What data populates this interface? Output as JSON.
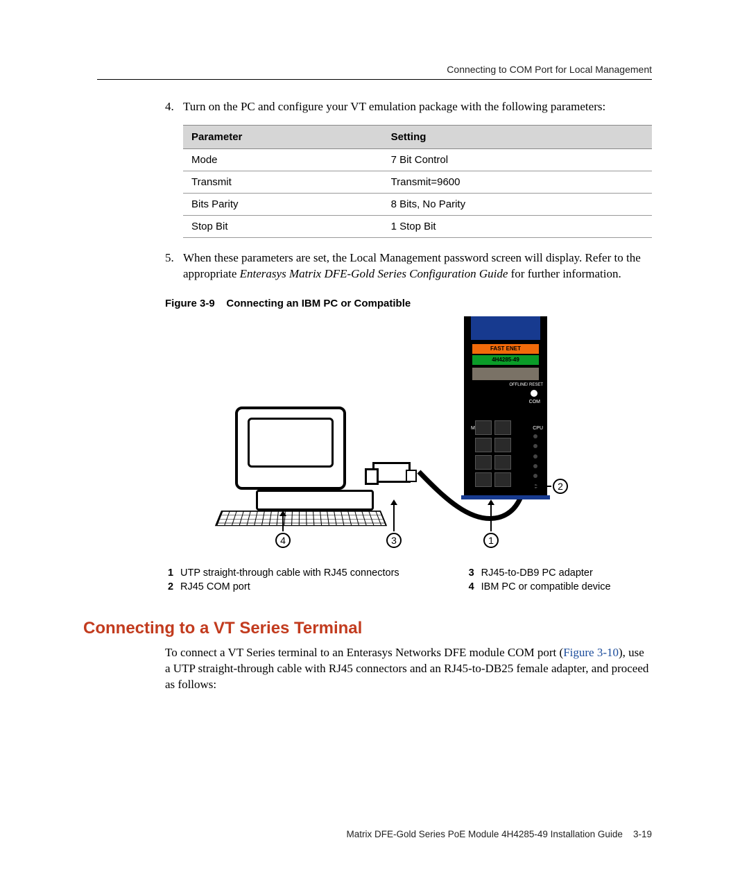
{
  "header": {
    "running_title": "Connecting to COM Port for Local Management"
  },
  "steps": {
    "s4": {
      "num": "4.",
      "text": "Turn on the PC and configure your VT emulation package with the following parameters:"
    },
    "s5": {
      "num": "5.",
      "text_a": "When these parameters are set, the Local Management password screen will display. Refer to the appropriate ",
      "text_em": "Enterasys Matrix DFE-Gold Series Configuration Guide",
      "text_b": " for further information."
    }
  },
  "param_table": {
    "headers": {
      "param": "Parameter",
      "setting": "Setting"
    },
    "rows": [
      {
        "param": "Mode",
        "setting": "7 Bit Control"
      },
      {
        "param": "Transmit",
        "setting": "Transmit=9600"
      },
      {
        "param": "Bits Parity",
        "setting": "8 Bits, No Parity"
      },
      {
        "param": "Stop Bit",
        "setting": "1 Stop Bit"
      }
    ]
  },
  "figure": {
    "caption_label": "Figure 3-9",
    "caption_text": "Connecting an IBM PC or Compatible",
    "callouts": {
      "c1": "1",
      "c2": "2",
      "c3": "3",
      "c4": "4"
    },
    "module_labels": {
      "fast_enet": "FAST ENET",
      "model": "4H4285-49",
      "offline": "OFFLINE/\nRESET",
      "com": "COM",
      "cpu": "CPU",
      "mg": "MG"
    },
    "legend": [
      {
        "k": "1",
        "v": "UTP straight-through cable with RJ45 connectors"
      },
      {
        "k": "2",
        "v": "RJ45 COM port"
      },
      {
        "k": "3",
        "v": "RJ45-to-DB9 PC adapter"
      },
      {
        "k": "4",
        "v": "IBM PC or compatible device"
      }
    ]
  },
  "section": {
    "heading": "Connecting to a VT Series Terminal",
    "para_a": "To connect a VT Series terminal to an Enterasys Networks DFE module COM port (",
    "xref": "Figure 3-10",
    "para_b": "), use a UTP straight-through cable with RJ45 connectors and an RJ45-to-DB25 female adapter, and proceed as follows:"
  },
  "footer": {
    "text": "Matrix DFE-Gold Series PoE Module 4H4285-49 Installation Guide",
    "page": "3-19"
  }
}
